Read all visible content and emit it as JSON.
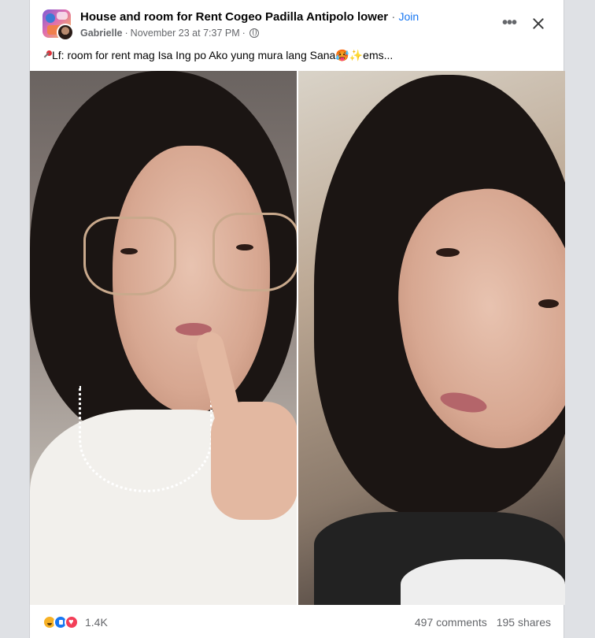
{
  "post": {
    "group_name": "House and room for Rent Cogeo Padilla Antipolo lower",
    "separator": "·",
    "join_label": "Join",
    "author": "Gabrielle",
    "timestamp": "November 23 at 7:37 PM",
    "privacy_icon": "globe-icon",
    "text": "Lf: room for rent mag Isa Ing po Ako yung mura lang Sana🥵✨ems...",
    "text_leading_icon": "pin-icon"
  },
  "header_actions": {
    "more_icon": "more-icon",
    "more_label": "•••",
    "close_icon": "close-icon"
  },
  "photos": [
    {
      "name": "photo-left"
    },
    {
      "name": "photo-right"
    }
  ],
  "footer": {
    "reaction_icons": [
      "haha-icon",
      "like-icon",
      "love-icon"
    ],
    "reaction_count": "1.4K",
    "comments": "497 comments",
    "shares": "195 shares"
  },
  "colors": {
    "link": "#1877f2",
    "secondary_text": "#65676b",
    "background": "#dfe1e5"
  }
}
